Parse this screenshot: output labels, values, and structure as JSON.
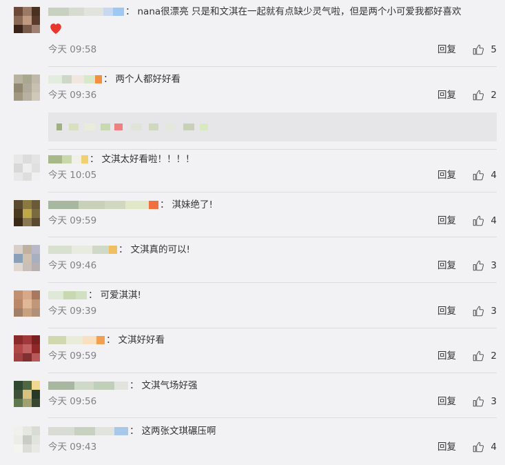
{
  "labels": {
    "reply": "回复",
    "colon": "："
  },
  "colors": {
    "background": "#f2f2f5",
    "text": "#333333",
    "time": "#808080",
    "divider": "#dcdcdc",
    "heart": "#e8362e"
  },
  "comments": [
    {
      "text": "nana很漂亮 只是和文淇在一起就有点缺少灵气啦，但是两个小可爱我都好喜欢",
      "has_heart": true,
      "time": "今天 09:58",
      "likes": "5",
      "avatar": [
        "#6b4a3a",
        "#9a7a64",
        "#4a3020",
        "#8a6a55",
        "#c09a80",
        "#5a3a2a",
        "#3a2418",
        "#7a5a48",
        "#a08070"
      ],
      "name_blocks": [
        "#c8d0c0",
        "#d8dcd0",
        "#e0e4dc",
        "#c8d8f0",
        "#9fc8f0"
      ]
    },
    {
      "text": "两个人都好好看",
      "has_heart": false,
      "time": "今天 09:36",
      "likes": "2",
      "avatar": [
        "#b8b2a0",
        "#a8a890",
        "#c0b8a8",
        "#908870",
        "#b0a898",
        "#c8c0b0",
        "#a09880",
        "#b8b0a0",
        "#d0c8b8"
      ],
      "name_blocks": [
        "#e4ece0",
        "#cfd8c8",
        "#f0e8e0",
        "#d8e8c8",
        "#f09040"
      ]
    },
    {
      "text": "文淇太好看啦！！！！",
      "has_heart": false,
      "time": "今天 10:05",
      "likes": "4",
      "avatar": [
        "#e8e8e8",
        "#dcdcdc",
        "#e4e4e4",
        "#d8d8d8",
        "#eeeeee",
        "#e0e0e0",
        "#e8e8e8",
        "#dedede",
        "#f0f0f0"
      ],
      "name_blocks": [
        "#a8b888",
        "#c8d8a8",
        "#f0f0e8",
        "#f0d070"
      ]
    },
    {
      "text": "淇妹绝了!",
      "has_heart": false,
      "time": "今天 09:59",
      "likes": "4",
      "avatar": [
        "#5a4a30",
        "#8a7a40",
        "#6a5a38",
        "#4a3a20",
        "#c0a848",
        "#7a6a40",
        "#3a2a18",
        "#8a7850",
        "#5a4a30"
      ],
      "name_blocks": [
        "#a8b8a0",
        "#c8d0b8",
        "#d0d8c0",
        "#e0e8c8",
        "#f07040"
      ]
    },
    {
      "text": "文淇真的可以!",
      "has_heart": false,
      "time": "今天 09:46",
      "likes": "3",
      "avatar": [
        "#d8d0c8",
        "#c0b0a0",
        "#b8b8c8",
        "#8aa0b8",
        "#d0c0b0",
        "#a8b0c0",
        "#e0d8d0",
        "#c8c0b8",
        "#b8b0b0"
      ],
      "name_blocks": [
        "#d8e0d0",
        "#e8ece0",
        "#d0d8c8",
        "#f0c060"
      ]
    },
    {
      "text": "可爱淇淇!",
      "has_heart": false,
      "time": "今天 09:39",
      "likes": "3",
      "avatar": [
        "#c09070",
        "#d8a888",
        "#a87860",
        "#b88868",
        "#e0b898",
        "#c09878",
        "#a08068",
        "#c8a080",
        "#b09078"
      ],
      "name_blocks": [
        "#e0e8d8",
        "#c8d8b0",
        "#d0e0c0"
      ]
    },
    {
      "text": "文淇好好看",
      "has_heart": false,
      "time": "今天 09:59",
      "likes": "2",
      "avatar": [
        "#8a2a2a",
        "#a03a3a",
        "#7a2020",
        "#b04848",
        "#c06060",
        "#902828",
        "#a04040",
        "#803030",
        "#b85858"
      ],
      "name_blocks": [
        "#d0d8b0",
        "#e8ecd8",
        "#f8e0c0",
        "#f0a050"
      ]
    },
    {
      "text": "文淇气场好强",
      "has_heart": false,
      "time": "今天 09:56",
      "likes": "3",
      "avatar": [
        "#304830",
        "#506840",
        "#f0d890",
        "#405038",
        "#d8c080",
        "#283828",
        "#607850",
        "#a0a070",
        "#384830"
      ],
      "name_blocks": [
        "#a8b8a0",
        "#d0d8c8",
        "#c0d0b8",
        "#e0e4dc"
      ]
    },
    {
      "text": "这两张文琪碾压啊",
      "has_heart": false,
      "time": "今天 09:43",
      "likes": "4",
      "avatar": [
        "#f0f0ec",
        "#e4e8e0",
        "#d8dcd4",
        "#ecece8",
        "#c8ccc4",
        "#e0e4dc",
        "#f4f4f0",
        "#dcdcd8",
        "#e8e8e4"
      ],
      "name_blocks": [
        "#d8dcd4",
        "#c8d0c0",
        "#e0e4dc",
        "#a8c8e8"
      ]
    }
  ]
}
